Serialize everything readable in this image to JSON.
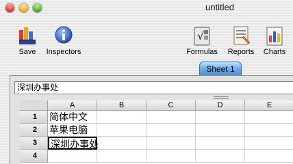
{
  "window": {
    "title": "untitled"
  },
  "toolbar": {
    "save_label": "Save",
    "inspectors_label": "Inspectors",
    "formulas_label": "Formulas",
    "reports_label": "Reports",
    "charts_label": "Charts"
  },
  "tabs": [
    {
      "label": "Sheet 1"
    }
  ],
  "formula_bar": {
    "value": "深圳办事处"
  },
  "grid": {
    "columns": [
      "A",
      "B",
      "C",
      "D",
      "E"
    ],
    "rows": [
      "1",
      "2",
      "3",
      "4"
    ],
    "cells": {
      "A1": "简体中文",
      "A2": "苹果电脑",
      "A3": "深圳办事处"
    },
    "selected_cell": "A3"
  }
}
